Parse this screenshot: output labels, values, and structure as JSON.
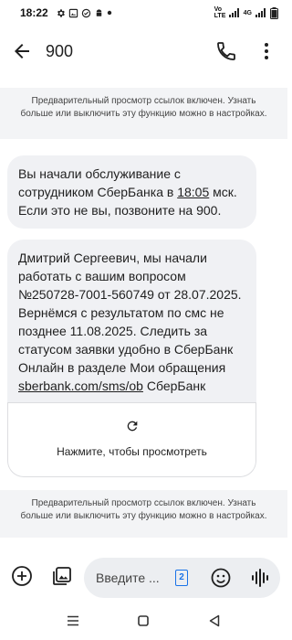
{
  "status_bar": {
    "time": "18:22",
    "volte_label": "Vo LTE",
    "network_label": "4G"
  },
  "header": {
    "title": "900"
  },
  "notices": [
    {
      "text": "Предварительный просмотр ссылок включен. Узнать больше или выключить эту функцию можно в настройках."
    },
    {
      "text": "Предварительный просмотр ссылок включен. Узнать больше или выключить эту функцию можно в настройках."
    }
  ],
  "messages": [
    {
      "text_before": "Вы начали обслуживание с сотрудником СберБанка в ",
      "time_link": "18:05",
      "text_after": " мск. Если это не вы, позвоните на 900."
    },
    {
      "text_before": "Дмитрий Сергеевич, мы начали работать с вашим вопросом №250728-7001-560749 от 28.07.2025. Вернёмся с результатом по смс не позднее 11.08.2025. Следить за статусом заявки удобно в СберБанк Онлайн в разделе Мои обращения ",
      "link": "sberbank.com/sms/ob",
      "text_after": " СберБанк",
      "preview_label": "Нажмите, чтобы просмотреть"
    }
  ],
  "compose": {
    "placeholder": "Введите ...",
    "sim_number": "2"
  },
  "colors": {
    "bubble": "#f0f1f4",
    "notice_bg": "#f3f4f6",
    "accent": "#1a73e8"
  },
  "icons": [
    "back-arrow-icon",
    "phone-icon",
    "more-vert-icon",
    "add-icon",
    "gallery-icon",
    "emoji-icon",
    "voice-icon",
    "refresh-icon"
  ]
}
